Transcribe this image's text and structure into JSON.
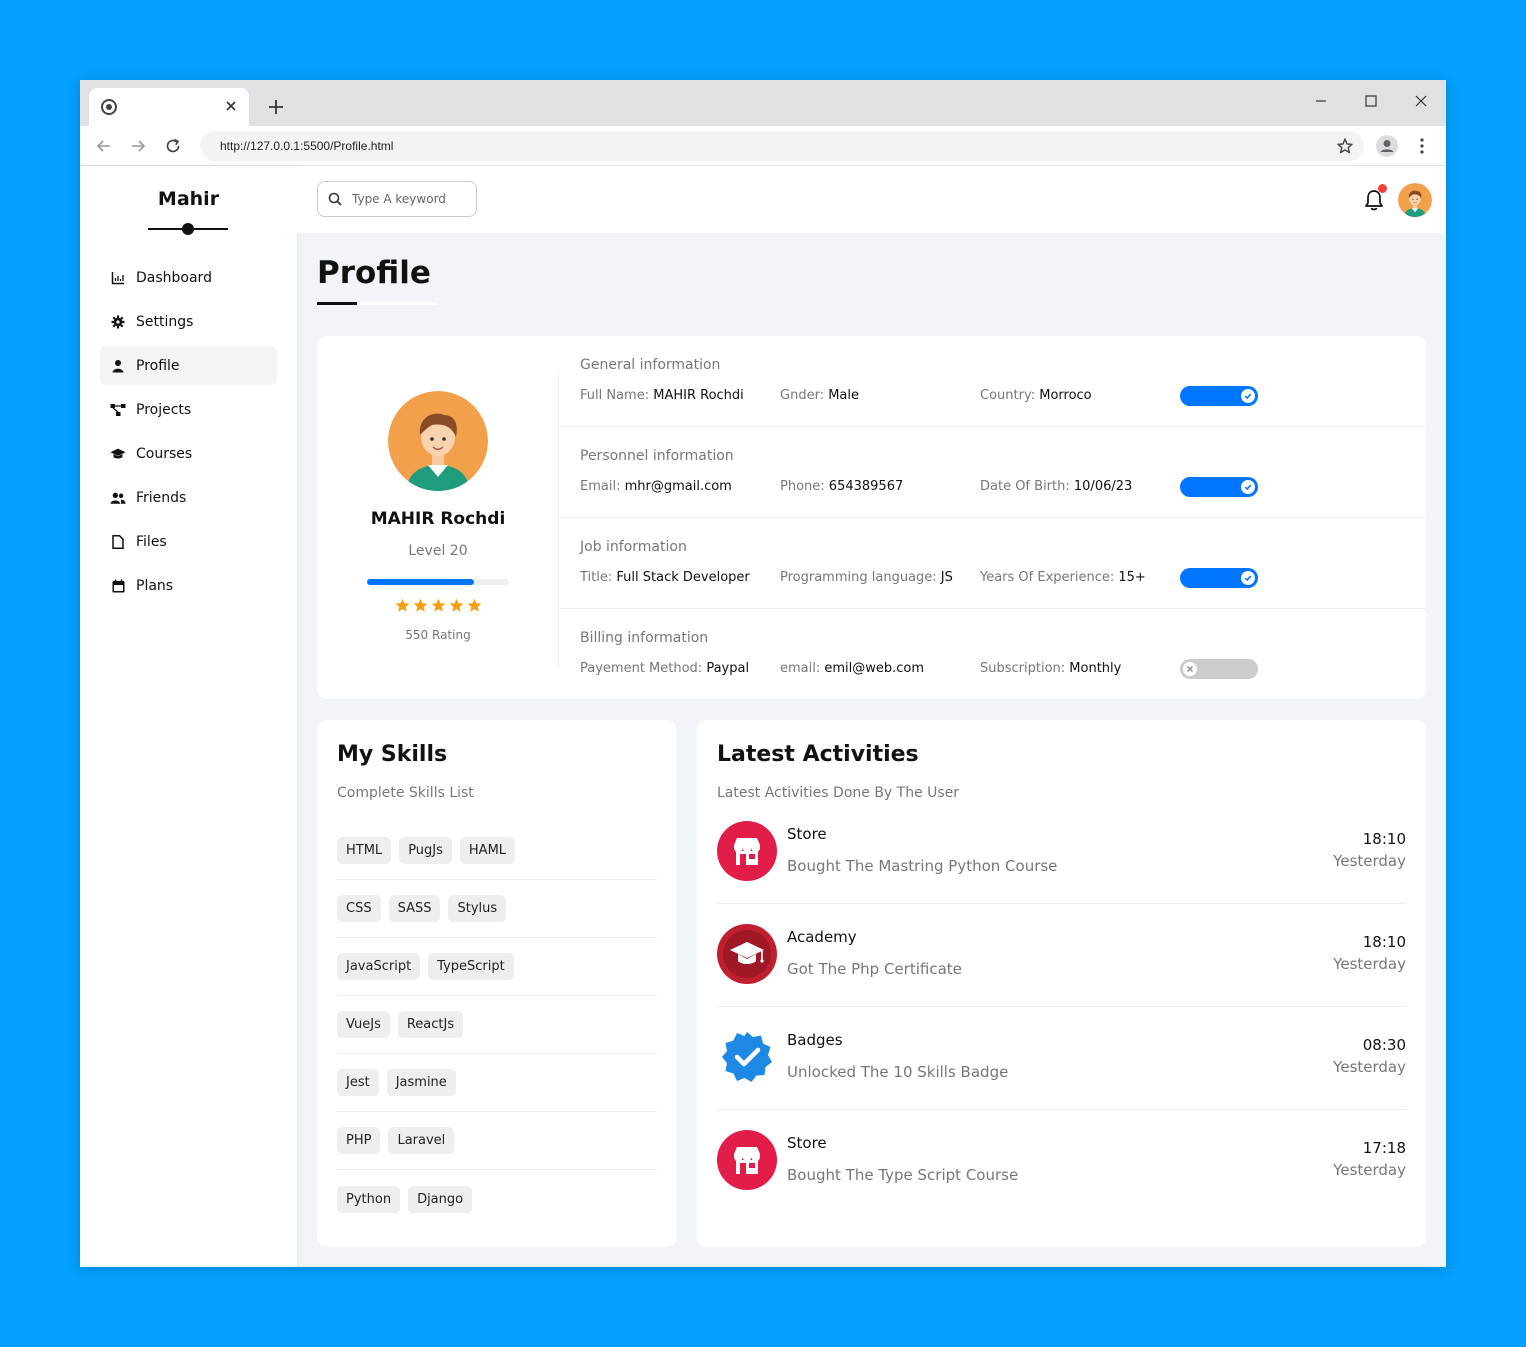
{
  "browser": {
    "url": "http://127.0.0.1:5500/Profile.html"
  },
  "sidebar": {
    "brand": "Mahir",
    "items": [
      {
        "label": "Dashboard",
        "icon": "chart-icon"
      },
      {
        "label": "Settings",
        "icon": "gear-icon"
      },
      {
        "label": "Profile",
        "icon": "user-icon",
        "active": true
      },
      {
        "label": "Projects",
        "icon": "diagram-icon"
      },
      {
        "label": "Courses",
        "icon": "graduation-cap-icon"
      },
      {
        "label": "Friends",
        "icon": "users-icon"
      },
      {
        "label": "Files",
        "icon": "file-icon"
      },
      {
        "label": "Plans",
        "icon": "calendar-icon"
      }
    ]
  },
  "topbar": {
    "search_placeholder": "Type A keyword"
  },
  "page": {
    "title": "Profile"
  },
  "profile": {
    "name": "MAHIR Rochdi",
    "level": "Level 20",
    "level_progress": 0.75,
    "stars": 5,
    "rating": "550 Rating",
    "sections": [
      {
        "heading": "General information",
        "toggle_on": true,
        "items": [
          {
            "label": "Full Name:",
            "value": "MAHIR Rochdi"
          },
          {
            "label": "Gnder:",
            "value": "Male"
          },
          {
            "label": "Country:",
            "value": "Morroco"
          }
        ]
      },
      {
        "heading": "Personnel information",
        "toggle_on": true,
        "items": [
          {
            "label": "Email:",
            "value": "mhr@gmail.com"
          },
          {
            "label": "Phone:",
            "value": "654389567"
          },
          {
            "label": "Date Of Birth:",
            "value": "10/06/23"
          }
        ]
      },
      {
        "heading": "Job information",
        "toggle_on": true,
        "items": [
          {
            "label": "Title:",
            "value": "Full Stack Developer"
          },
          {
            "label": "Programming language:",
            "value": "JS"
          },
          {
            "label": "Years Of Experience:",
            "value": "15+"
          }
        ]
      },
      {
        "heading": "Billing information",
        "toggle_on": false,
        "items": [
          {
            "label": "Payement Method:",
            "value": "Paypal"
          },
          {
            "label": "email:",
            "value": "emil@web.com"
          },
          {
            "label": "Subscription:",
            "value": "Monthly"
          }
        ]
      }
    ]
  },
  "skills": {
    "title": "My Skills",
    "subtitle": "Complete Skills List",
    "rows": [
      [
        "HTML",
        "PugJs",
        "HAML"
      ],
      [
        "CSS",
        "SASS",
        "Stylus"
      ],
      [
        "JavaScript",
        "TypeScript"
      ],
      [
        "VueJs",
        "ReactJs"
      ],
      [
        "Jest",
        "Jasmine"
      ],
      [
        "PHP",
        "Laravel"
      ],
      [
        "Python",
        "Django"
      ]
    ]
  },
  "activities": {
    "title": "Latest Activities",
    "subtitle": "Latest Activities Done By The User",
    "items": [
      {
        "name": "Store",
        "desc": "Bought The Mastring Python Course",
        "time": "18:10",
        "day": "Yesterday",
        "icon": "store-icon"
      },
      {
        "name": "Academy",
        "desc": "Got The Php Certificate",
        "time": "18:10",
        "day": "Yesterday",
        "icon": "academy-icon"
      },
      {
        "name": "Badges",
        "desc": "Unlocked The 10 Skills Badge",
        "time": "08:30",
        "day": "Yesterday",
        "icon": "badge-icon"
      },
      {
        "name": "Store",
        "desc": "Bought The Type Script Course",
        "time": "17:18",
        "day": "Yesterday",
        "icon": "store-icon"
      }
    ]
  },
  "colors": {
    "accent": "#0075ff",
    "page_background": "#f1f5f9",
    "star": "#f59e0b",
    "store_red": "#e11d48",
    "academy_red": "#c0202e",
    "badge_blue": "#1e88e5"
  }
}
